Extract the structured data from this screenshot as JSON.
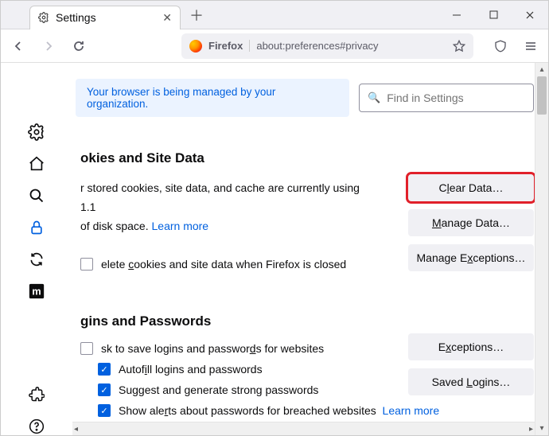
{
  "titlebar": {
    "tab_title": "Settings"
  },
  "toolbar": {
    "identity_label": "Firefox",
    "url": "about:preferences#privacy"
  },
  "banner": "Your browser is being managed by your organization.",
  "search_placeholder": "Find in Settings",
  "cookies": {
    "heading": "okies and Site Data",
    "desc_line1": "r stored cookies, site data, and cache are currently using 1.1",
    "desc_line2_prefix": "of disk space.  ",
    "learn_more": "Learn more",
    "delete_label": "elete cookies and site data when Firefox is closed",
    "buttons": {
      "clear_pre": "C",
      "clear_u": "l",
      "clear_post": "ear Data…",
      "manage_pre": "",
      "manage_u": "M",
      "manage_post": "anage Data…",
      "except_pre": "Manage E",
      "except_u": "x",
      "except_post": "ceptions…"
    }
  },
  "logins": {
    "heading": "gins and Passwords",
    "ask_pre": "sk to save logins and passwor",
    "ask_u": "d",
    "ask_post": "s for websites",
    "autofill_pre": "Autof",
    "autofill_u": "i",
    "autofill_post": "ll logins and passwords",
    "suggest_pre": "Su",
    "suggest_u": "g",
    "suggest_post": "gest and generate strong passwords",
    "breach_pre": "Show ale",
    "breach_u": "r",
    "breach_post": "ts about passwords for breached websites",
    "learn_more": "Learn more",
    "buttons": {
      "except_pre": "E",
      "except_u": "x",
      "except_post": "ceptions…",
      "saved_pre": "Saved ",
      "saved_u": "L",
      "saved_post": "ogins…"
    }
  }
}
